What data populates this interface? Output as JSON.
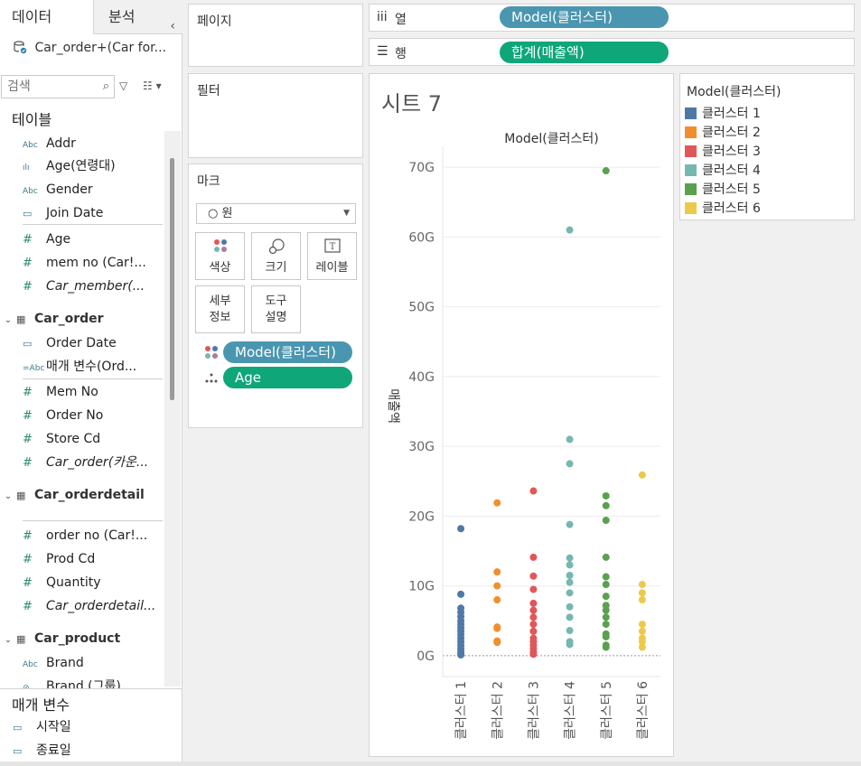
{
  "left_panel": {
    "tab_data": "데이터",
    "tab_analysis": "분석",
    "collapse_glyph": "‹",
    "source_name": "Car_order+(Car for...",
    "search_placeholder": "검색",
    "tables_header": "테이블",
    "top_fields": [
      {
        "icon": "Abc",
        "label": "Addr"
      },
      {
        "icon": "ılı",
        "label": "Age(연령대)"
      },
      {
        "icon": "Abc",
        "label": "Gender"
      },
      {
        "icon": "▭",
        "label": "Join Date"
      },
      {
        "icon": "#",
        "label": "Age"
      },
      {
        "icon": "#",
        "label": "mem no (Car!..."
      },
      {
        "icon": "#",
        "label": "Car_member(..."
      }
    ],
    "groups": [
      {
        "name": "Car_order",
        "fields": [
          {
            "icon": "▭",
            "label": "Order Date"
          },
          {
            "icon": "=Abc",
            "label": "매개 변수(Ord..."
          },
          {
            "icon": "#",
            "label": "Mem No"
          },
          {
            "icon": "#",
            "label": "Order No"
          },
          {
            "icon": "#",
            "label": "Store Cd"
          },
          {
            "icon": "#",
            "label": "Car_order(카운..."
          }
        ]
      },
      {
        "name": "Car_orderdetail",
        "fields": [
          {
            "icon": "#",
            "label": "order no (Car!..."
          },
          {
            "icon": "#",
            "label": "Prod Cd"
          },
          {
            "icon": "#",
            "label": "Quantity"
          },
          {
            "icon": "#",
            "label": "Car_orderdetail..."
          }
        ]
      },
      {
        "name": "Car_product",
        "fields": [
          {
            "icon": "Abc",
            "label": "Brand"
          },
          {
            "icon": "⊘",
            "label": "Brand (그룹)"
          }
        ]
      }
    ],
    "parameters_header": "매개 변수",
    "parameters": [
      {
        "icon": "▭",
        "label": "시작일"
      },
      {
        "icon": "▭",
        "label": "종료일"
      }
    ]
  },
  "cards": {
    "pages_title": "페이지",
    "filters_title": "필터",
    "marks_title": "마크",
    "mark_type": "원",
    "mark_buttons": {
      "color": "색상",
      "size": "크기",
      "label": "레이블",
      "detail_l1": "세부",
      "detail_l2": "정보",
      "tooltip_l1": "도구",
      "tooltip_l2": "설명"
    },
    "mark_pills": [
      {
        "label": "Model(클러스터)",
        "color": "#4a96b0"
      },
      {
        "label": "Age",
        "color": "#0fa67a"
      }
    ]
  },
  "shelves": {
    "columns_icon": "iii",
    "columns_label": "열",
    "columns_pill": "Model(클러스터)",
    "rows_icon": "☰",
    "rows_label": "행",
    "rows_pill": "합계(매출액)"
  },
  "sheet": {
    "title": "시트 7"
  },
  "legend": {
    "title": "Model(클러스터)",
    "items": [
      {
        "label": "클러스터 1",
        "color": "#4e79a7"
      },
      {
        "label": "클러스터 2",
        "color": "#f28e2b"
      },
      {
        "label": "클러스터 3",
        "color": "#e15759"
      },
      {
        "label": "클러스터 4",
        "color": "#76b7b2"
      },
      {
        "label": "클러스터 5",
        "color": "#59a14f"
      },
      {
        "label": "클러스터 6",
        "color": "#edc948"
      }
    ]
  },
  "chart_data": {
    "type": "scatter",
    "title": "Model(클러스터)",
    "ylabel": "매출액",
    "ylim": [
      -3,
      73
    ],
    "yticks": [
      0,
      10,
      20,
      30,
      40,
      50,
      60,
      70
    ],
    "ytick_labels": [
      "0G",
      "10G",
      "20G",
      "30G",
      "40G",
      "50G",
      "60G",
      "70G"
    ],
    "categories": [
      "클러스터 1",
      "클러스터 2",
      "클러스터 3",
      "클러스터 4",
      "클러스터 5",
      "클러스터 6"
    ],
    "grid": true,
    "series": [
      {
        "name": "클러스터 1",
        "color": "#4e79a7",
        "values": [
          18.2,
          8.8,
          6.8,
          6.2,
          5.6,
          5.0,
          4.5,
          4.0,
          3.5,
          3.0,
          2.5,
          2.0,
          1.5,
          1.0,
          0.6,
          0.3,
          0.1
        ]
      },
      {
        "name": "클러스터 2",
        "color": "#f28e2b",
        "values": [
          21.9,
          12.0,
          10.0,
          8.0,
          4.1,
          3.9,
          2.1,
          1.9
        ]
      },
      {
        "name": "클러스터 3",
        "color": "#e15759",
        "values": [
          23.6,
          14.1,
          11.4,
          9.5,
          7.5,
          6.5,
          5.5,
          4.5,
          3.5,
          2.5,
          2.0,
          1.5,
          1.0,
          0.5,
          0.2
        ]
      },
      {
        "name": "클러스터 4",
        "color": "#76b7b2",
        "values": [
          61.0,
          31.0,
          27.5,
          18.8,
          14.0,
          13.0,
          11.5,
          10.5,
          9.0,
          7.0,
          5.5,
          3.6,
          2.0,
          1.6
        ]
      },
      {
        "name": "클러스터 5",
        "color": "#59a14f",
        "values": [
          69.5,
          22.9,
          21.5,
          19.4,
          14.1,
          11.3,
          10.2,
          8.5,
          7.2,
          6.5,
          5.5,
          4.5,
          3.1,
          2.7,
          1.5,
          1.2
        ]
      },
      {
        "name": "클러스터 6",
        "color": "#edc948",
        "values": [
          25.9,
          10.2,
          9.0,
          8.0,
          4.5,
          3.5,
          2.5,
          2.0,
          1.2
        ]
      }
    ]
  }
}
